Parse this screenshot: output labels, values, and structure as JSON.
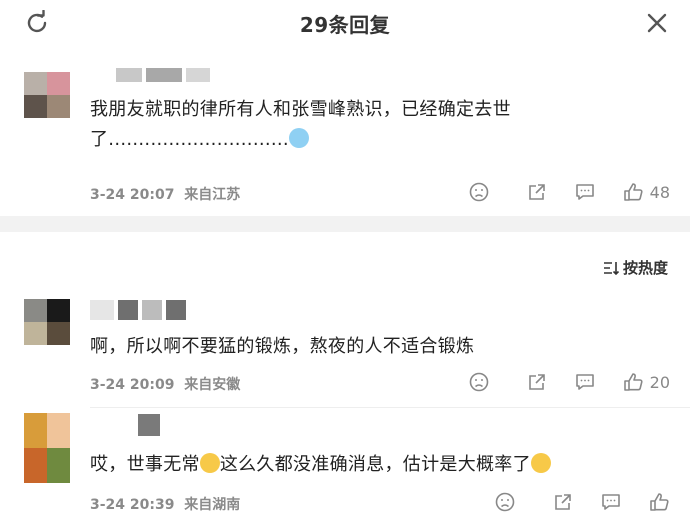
{
  "header": {
    "title": "29条回复"
  },
  "sort_label": "按热度",
  "comments": [
    {
      "text": "我朋友就职的律所有人和张雪峰熟识，已经确定去世了..............................",
      "time": "3-24 20:07",
      "location": "来自江苏",
      "likes": "48"
    },
    {
      "text": "啊，所以啊不要猛的锻炼，熬夜的人不适合锻炼",
      "time": "3-24 20:09",
      "location": "来自安徽",
      "likes": "20"
    },
    {
      "text_a": "哎，世事无常",
      "text_b": "这么久都没准确消息，估计是大概率了",
      "time": "3-24 20:39",
      "location": "来自湖南"
    }
  ]
}
